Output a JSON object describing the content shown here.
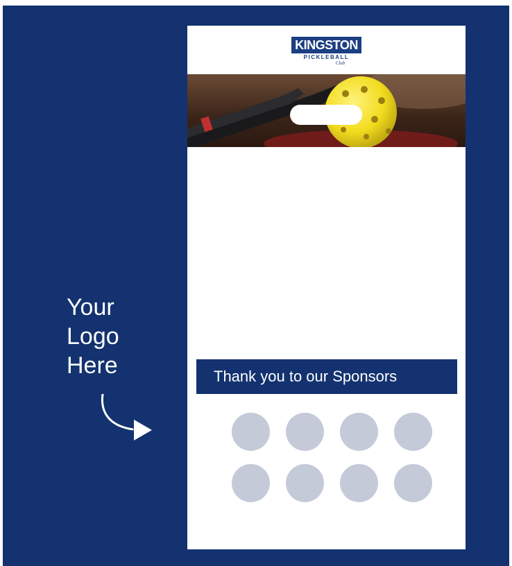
{
  "side_label": {
    "line1": "Your",
    "line2": "Logo",
    "line3": "Here"
  },
  "logo": {
    "main": "KINGSTON",
    "sub": "PICKLEBALL",
    "club": "Club"
  },
  "sponsor_bar": {
    "text": "Thank you to our Sponsors"
  },
  "sponsor_slots": 8,
  "colors": {
    "navy": "#13326f",
    "circle": "#c5cad9",
    "ball": "#f2dc1e"
  }
}
